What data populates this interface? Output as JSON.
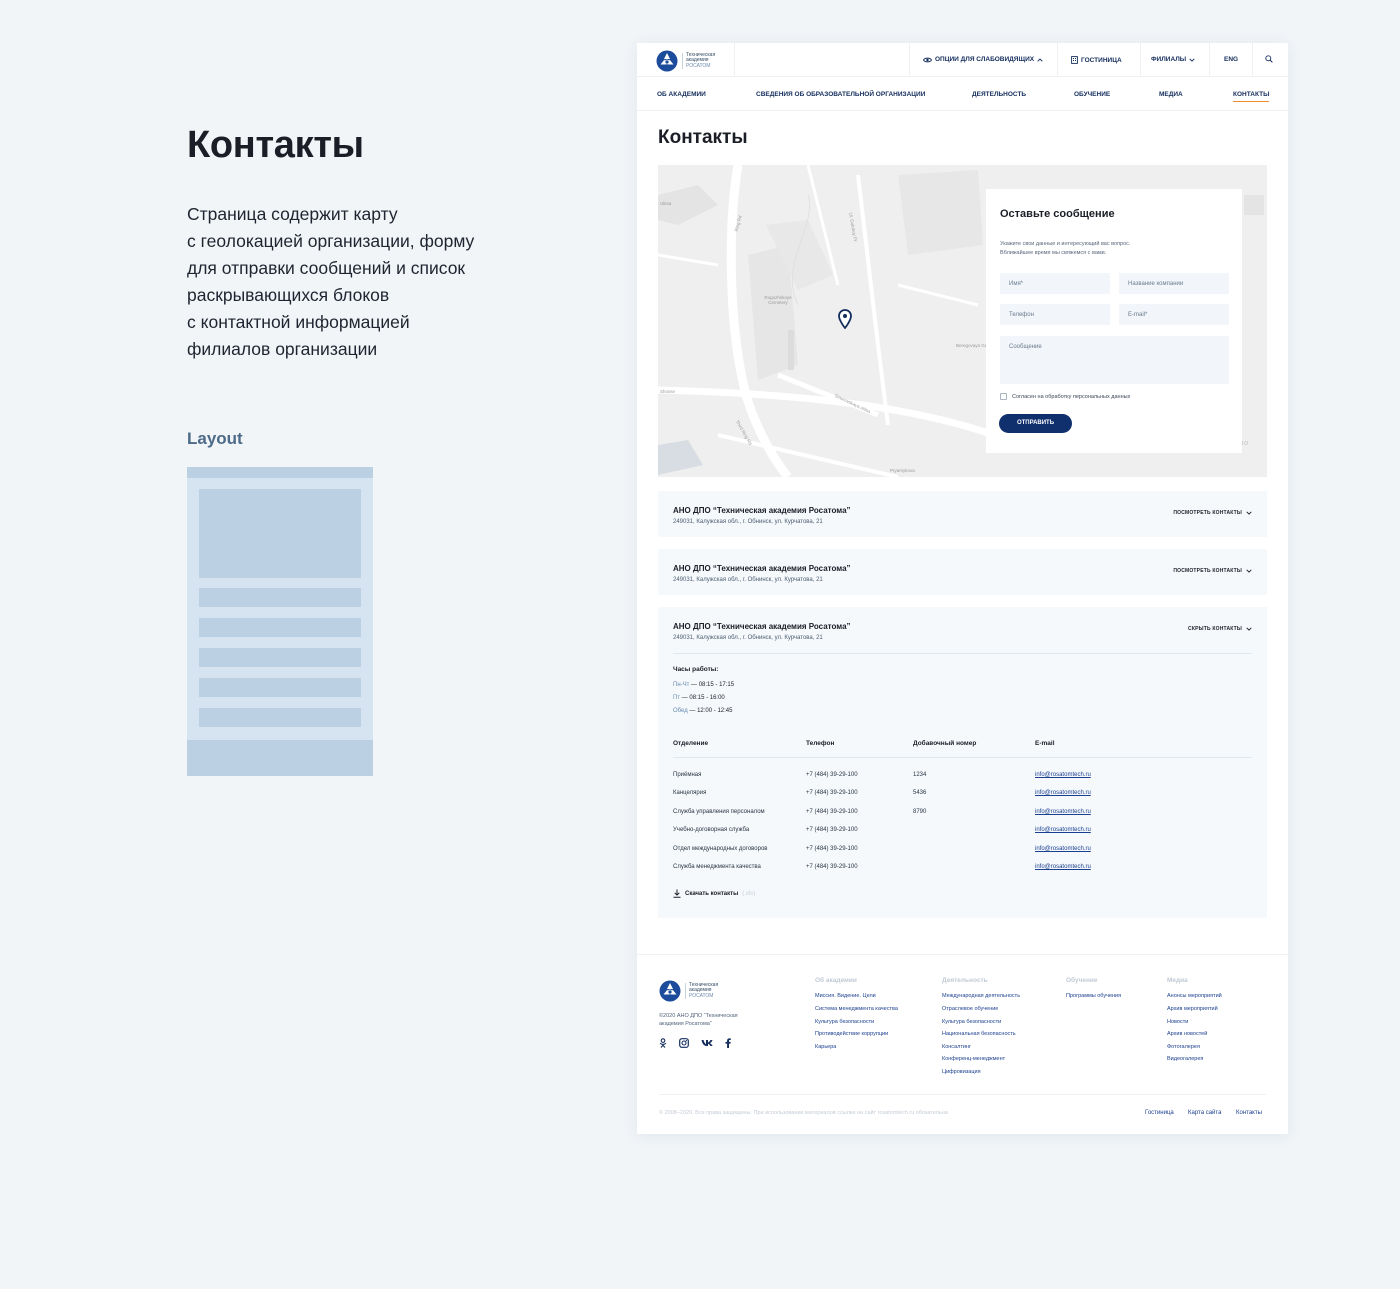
{
  "description": {
    "title": "Контакты",
    "lines": [
      "Страница содержит карту",
      "с геолокацией организации, форму",
      "для отправки сообщений и список",
      "раскрывающихся блоков",
      "с контактной информацией",
      "филиалов организации"
    ],
    "layout_label": "Layout"
  },
  "logo": {
    "line1": "Техническая",
    "line2": "академия",
    "line3": "РОСАТОМ"
  },
  "topbar": {
    "accessibility": "ОПЦИИ ДЛЯ СЛАБОВИДЯЩИХ",
    "hotel": "ГОСТИНИЦА",
    "branches": "ФИЛИАЛЫ",
    "lang": "ENG"
  },
  "nav": {
    "about": "ОБ АКАДЕМИИ",
    "info": "СВЕДЕНИЯ ОБ ОБРАЗОВАТЕЛЬНОЙ ОРГАНИЗАЦИИ",
    "activity": "ДЕЯТЕЛЬНОСТЬ",
    "education": "ОБУЧЕНИЕ",
    "media": "МЕДИА",
    "contacts": "КОНТАКТЫ"
  },
  "page_title": "Контакты",
  "map": {
    "labels": {
      "a": "Ring Rd",
      "b": "Ul. Goluboy Pr.",
      "c": "Rogozhskoye Cemetery",
      "d": "Beregovaya Gara",
      "e": "Smurovskaya ulitsa",
      "f": "Third Ring Rd",
      "g": "Pryamykova",
      "h": "Ulitsa",
      "i": "Shosse",
      "copy": "РОВО"
    }
  },
  "form": {
    "title": "Оставьте сообщение",
    "hint_line1": "Укажите свои данные и интересующий вас вопрос.",
    "hint_line2": "Вближайшее время мы свяжемся с вами.",
    "name": "Имя*",
    "company": "Название компании",
    "phone": "Телефон",
    "email": "E-mail*",
    "message": "Сообщение",
    "agree": "Согласен на обработку персональных данных",
    "submit": "ОТПРАВИТЬ"
  },
  "branches": [
    {
      "title": "АНО ДПО “Техническая академия Росатома”",
      "address": "249031, Калужская обл., г. Обнинск, ул. Курчатова, 21",
      "toggle": "ПОСМОТРЕТЬ КОНТАКТЫ"
    },
    {
      "title": "АНО ДПО “Техническая академия Росатома”",
      "address": "249031, Калужская обл., г. Обнинск, ул. Курчатова, 21",
      "toggle": "ПОСМОТРЕТЬ КОНТАКТЫ"
    },
    {
      "title": "АНО ДПО “Техническая академия Росатома”",
      "address": "249031, Калужская обл., г. Обнинск, ул. Курчатова, 21",
      "toggle": "СКРЫТЬ КОНТАКТЫ"
    }
  ],
  "hours": {
    "title": "Часы работы:",
    "rows": [
      {
        "label": "Пн-Чт",
        "value": "08:15 - 17:15"
      },
      {
        "label": "Пт",
        "value": "08:15 - 16:00"
      },
      {
        "label": "Обед",
        "value": "12:00 - 12:45"
      }
    ]
  },
  "table": {
    "headers": [
      "Отделение",
      "Телефон",
      "Добавочный номер",
      "E-mail"
    ],
    "rows": [
      [
        "Приёмная",
        "+7 (484) 39-29-100",
        "1234",
        "info@rosatomtech.ru"
      ],
      [
        "Канцелярия",
        "+7 (484) 39-29-100",
        "5436",
        "info@rosatomtech.ru"
      ],
      [
        "Служба управления персоналом",
        "+7 (484) 39-29-100",
        "8790",
        "info@rosatomtech.ru"
      ],
      [
        "Учебно-договорная служба",
        "+7 (484) 39-29-100",
        "",
        "info@rosatomtech.ru"
      ],
      [
        "Отдел международных договоров",
        "+7 (484) 39-29-100",
        "",
        "info@rosatomtech.ru"
      ],
      [
        "Служба менеджмента качества",
        "+7 (484) 39-29-100",
        "",
        "info@rosatomtech.ru"
      ]
    ],
    "download": "Скачать контакты",
    "download_format": "(.xls)"
  },
  "footer": {
    "copyright_line1": "©2020 АНО ДПО “Техническая",
    "copyright_line2": "академия Росатома”",
    "cols": [
      {
        "title": "Об академии",
        "items": [
          "Миссия. Видение. Цели",
          "Система менеджмента качества",
          "Культура безопасности",
          "Противодействие коррупции",
          "Карьера"
        ]
      },
      {
        "title": "Деятельность",
        "items": [
          "Международная деятельность",
          "Отраслевое обучение",
          "Культура безопасности",
          "Национальная безопасность",
          "Консалтинг",
          "Конференц-менеджмент",
          "Цифровизация"
        ]
      },
      {
        "title": "Обучение",
        "items": [
          "Программы обучения"
        ]
      },
      {
        "title": "Медиа",
        "items": [
          "Анонсы мероприятий",
          "Архив мероприятий",
          "Новости",
          "Архив новостей",
          "Фотогалерея",
          "Видеогалерея"
        ]
      }
    ],
    "rights": "© 2008–2020. Все права защищены. При использовании материалов ссылка на сайт rosatomtech.ru обязательна",
    "links": [
      "Гостиница",
      "Карта сайта",
      "Контакты"
    ]
  },
  "colors": {
    "brand_navy": "#0f2f6d",
    "accent_orange": "#ef8b2c",
    "background": "#f1f5f8"
  }
}
